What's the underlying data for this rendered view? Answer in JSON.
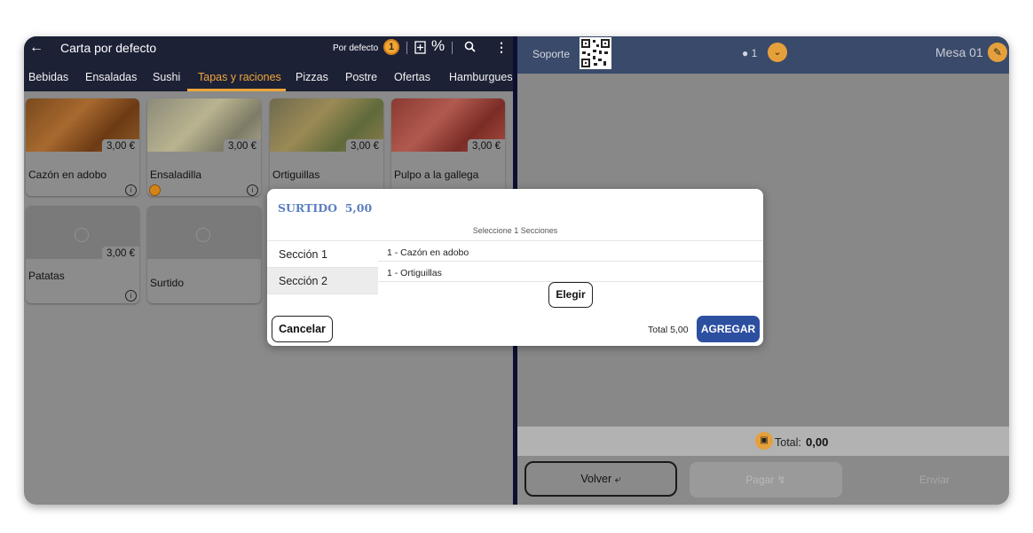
{
  "left": {
    "title": "Carta por defecto",
    "mode_label": "Por defecto",
    "badge_count": "1",
    "percent_icon": "%",
    "tabs": [
      {
        "label": "Bebidas"
      },
      {
        "label": "Ensaladas"
      },
      {
        "label": "Sushi"
      },
      {
        "label": "Tapas y raciones"
      },
      {
        "label": "Pizzas"
      },
      {
        "label": "Postre"
      },
      {
        "label": "Ofertas"
      },
      {
        "label": "Hamburguesa"
      }
    ],
    "active_tab": "Tapas y raciones",
    "products": [
      {
        "name": "Cazón en adobo",
        "price": "3,00 €"
      },
      {
        "name": "Ensaladilla",
        "price": "3,00 €"
      },
      {
        "name": "Ortiguillas",
        "price": "3,00 €"
      },
      {
        "name": "Pulpo a la gallega",
        "price": "3,00 €"
      },
      {
        "name": "Patatas",
        "price": "3,00 €"
      },
      {
        "name": "Surtido",
        "price": ""
      }
    ]
  },
  "right": {
    "support_label": "Soporte",
    "users_count": "1",
    "table_label": "Mesa 01",
    "total_label": "Total:",
    "total_value": "0,00",
    "back_button": "Volver",
    "pay_button": "Pagar",
    "send_button": "Enviar"
  },
  "modal": {
    "title": "SURTIDO",
    "title_price": "5,00",
    "subtitle": "Seleccione 1 Secciones",
    "sections": [
      {
        "label": "Sección 1"
      },
      {
        "label": "Sección 2"
      }
    ],
    "options": [
      {
        "label": "1 - Cazón en adobo"
      },
      {
        "label": "1 - Ortiguillas"
      }
    ],
    "choose_button": "Elegir",
    "cancel_button": "Cancelar",
    "total_label": "Total 5,00",
    "add_button": "AGREGAR"
  },
  "colors": {
    "header_dark": "#1d2136",
    "accent_orange": "#f0a63a",
    "primary_blue": "#2d4fa0",
    "right_header": "#3a4a6a"
  }
}
